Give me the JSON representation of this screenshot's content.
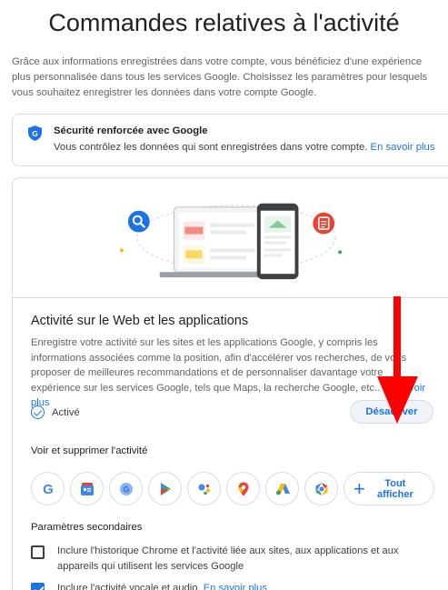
{
  "page": {
    "title": "Commandes relatives à l'activité",
    "intro": "Grâce aux informations enregistrées dans votre compte, vous bénéficiez d'une expérience plus personnalisée dans tous les services Google. Choisissez les paramètres pour lesquels vous souhaitez enregistrer les données dans votre compte Google."
  },
  "security": {
    "title": "Sécurité renforcée avec Google",
    "text": "Vous contrôlez les données qui sont enregistrées dans votre compte.",
    "link": "En savoir plus",
    "icon": "shield-icon"
  },
  "web_activity": {
    "title": "Activité sur le Web et les applications",
    "description": "Enregistre votre activité sur les sites et les applications Google, y compris les informations associées comme la position, afin d'accélérer vos recherches, de vous proposer de meilleures recommandations et de personnaliser davantage votre expérience sur les services Google, tels que Maps, la recherche Google, etc..",
    "link": "En savoir plus",
    "status": "Activé",
    "disable_button": "Désactiver"
  },
  "view_delete": {
    "label": "Voir et supprimer l'activité",
    "apps": [
      "google-icon",
      "google-news-icon",
      "google-lens-icon",
      "google-play-icon",
      "google-assistant-icon",
      "google-maps-icon",
      "google-ads-icon",
      "chrome-icon"
    ],
    "show_all": "Tout afficher"
  },
  "secondary": {
    "label": "Paramètres secondaires",
    "chrome_history": "Inclure l'historique Chrome et l'activité liée aux sites, aux applications et aux appareils qui utilisent les services Google",
    "chrome_history_checked": false,
    "voice_audio": "Inclure l'activité vocale et audio.",
    "voice_audio_link": "En savoir plus",
    "voice_audio_checked": true
  },
  "colors": {
    "accent": "#1a73e8",
    "annotation_arrow": "#ff0000"
  }
}
